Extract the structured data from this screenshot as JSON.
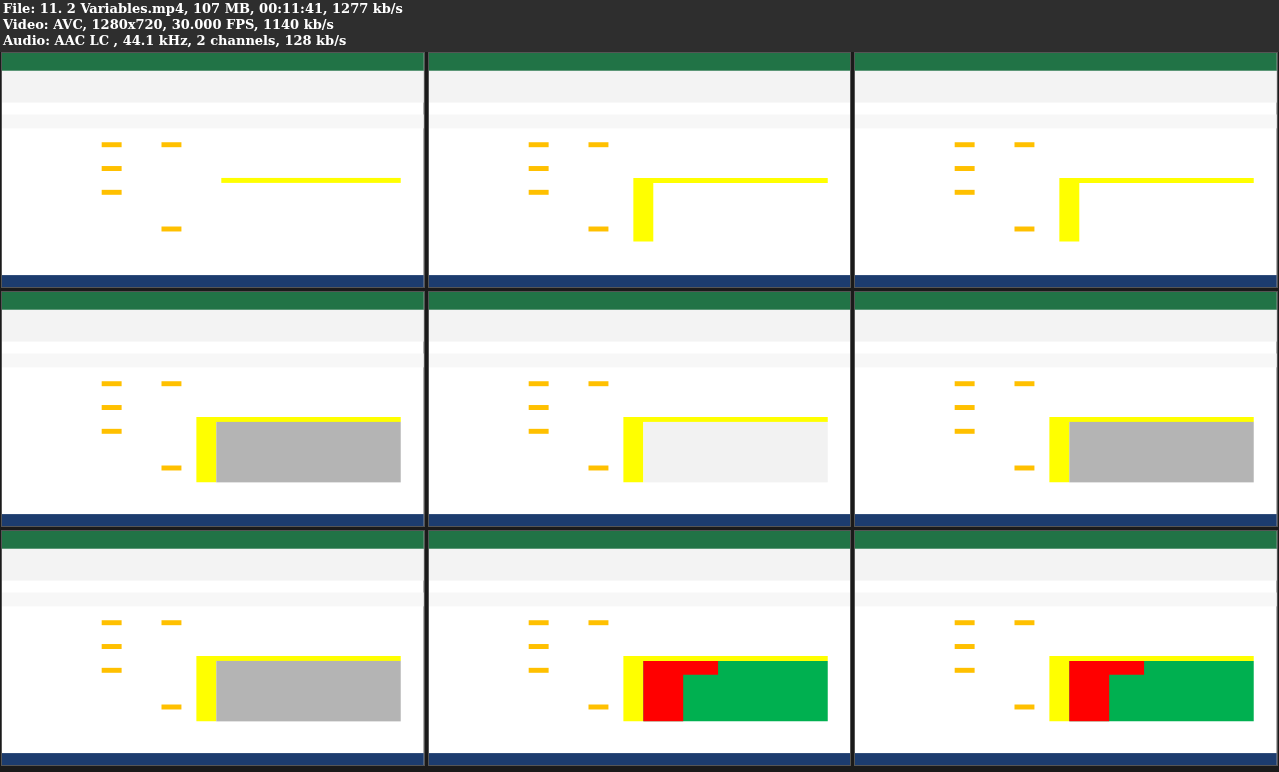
{
  "file_info": [
    "File: 11. 2 Variables.mp4, 107 MB, 00:11:41, 1277 kb/s",
    "Video: AVC, 1280x720, 30.000 FPS, 1140 kb/s",
    "Audio: AAC LC , 44.1 kHz, 2 channels, 128 kb/s"
  ]
}
